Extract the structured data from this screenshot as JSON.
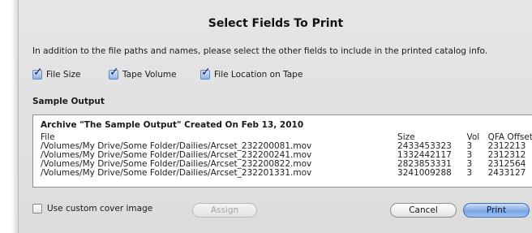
{
  "dialog": {
    "title": "Select Fields To Print",
    "instructions": "In addition to the file paths and names, please select the other fields to include in the printed catalog info."
  },
  "fields": [
    {
      "label": "File Size",
      "checked": true
    },
    {
      "label": "Tape Volume",
      "checked": true
    },
    {
      "label": "File Location on Tape",
      "checked": true
    }
  ],
  "sample": {
    "label": "Sample Output",
    "heading": "Archive \"The Sample Output\" Created On Feb 13, 2010",
    "columns": [
      "File",
      "Size",
      "Vol",
      "QFA Offset"
    ],
    "rows": [
      [
        "/Volumes/My Drive/Some Folder/Dailies/Arcset_232200081.mov",
        "2433453323",
        "3",
        "2312213"
      ],
      [
        "/Volumes/My Drive/Some Folder/Dailies/Arcset_232200241.mov",
        "1332442117",
        "3",
        "2312312"
      ],
      [
        "/Volumes/My Drive/Some Folder/Dailies/Arcset_232200822.mov",
        "2823853331",
        "3",
        "2312564"
      ],
      [
        "/Volumes/My Drive/Some Folder/Dailies/Arcset_232201331.mov",
        "3241009288",
        "3",
        "2433127"
      ]
    ]
  },
  "footer": {
    "custom_cover_label": "Use custom cover image",
    "custom_cover_checked": false,
    "assign_label": "Assign",
    "cancel_label": "Cancel",
    "print_label": "Print"
  },
  "icons": {
    "checkmark": "✓"
  },
  "colors": {
    "sheet_bg": "#e0e0e0",
    "default_button": "#79a5e6",
    "checkbox_checked": "#8fb3ec"
  }
}
